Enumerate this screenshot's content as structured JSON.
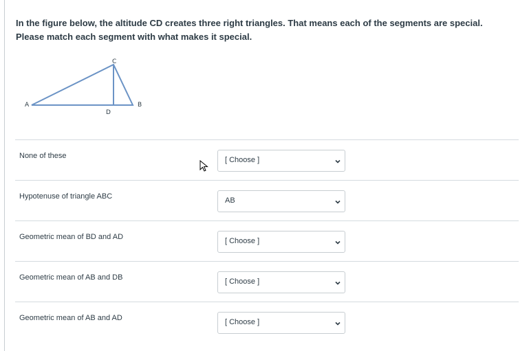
{
  "question": {
    "text": "In the figure below, the altitude CD creates three right triangles. That means each of the segments are special. Please match each segment with what makes it special."
  },
  "figure": {
    "labels": {
      "a": "A",
      "b": "B",
      "c": "C",
      "d": "D"
    },
    "line_color": "#6b93c5"
  },
  "rows": [
    {
      "label": "None of these",
      "selected": "[ Choose ]"
    },
    {
      "label": "Hypotenuse of triangle ABC",
      "selected": "AB"
    },
    {
      "label": "Geometric mean of BD and AD",
      "selected": "[ Choose ]"
    },
    {
      "label": "Geometric mean of AB and DB",
      "selected": "[ Choose ]"
    },
    {
      "label": "Geometric mean of AB and AD",
      "selected": "[ Choose ]"
    }
  ],
  "icons": {
    "dropdown": "chevron-down-icon",
    "cursor": "mouse-pointer-icon"
  }
}
